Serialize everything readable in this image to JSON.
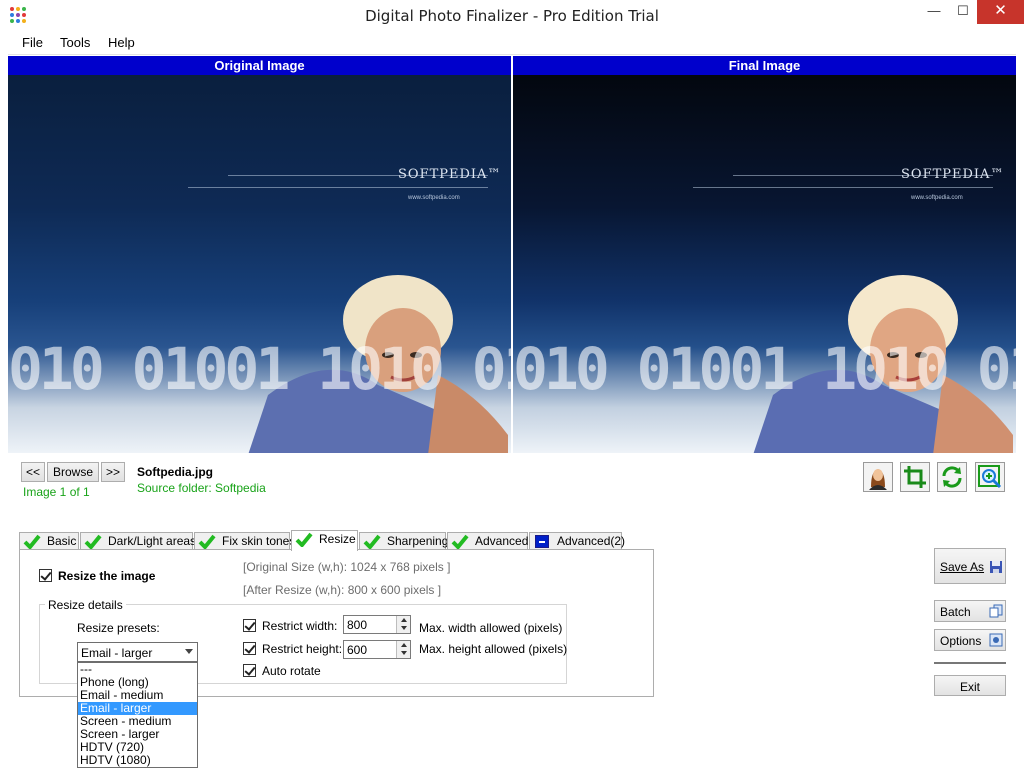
{
  "window": {
    "title": "Digital Photo Finalizer - Pro Edition Trial",
    "minimize_glyph": "—",
    "maximize_glyph": "☐",
    "close_glyph": "✕"
  },
  "menu": [
    "File",
    "Tools",
    "Help"
  ],
  "panels": {
    "original_label": "Original Image",
    "final_label": "Final Image",
    "brand": "SOFTPEDIA™",
    "url": "www.softpedia.com"
  },
  "navigation": {
    "prev_label": "<<",
    "browse_label": "Browse",
    "next_label": ">>",
    "image_counter": "Image 1 of 1",
    "file_name": "Softpedia.jpg",
    "source_folder": "Source folder: Softpedia"
  },
  "tools": [
    "portrait-icon",
    "crop-icon",
    "rotate-icon",
    "zoom-icon"
  ],
  "tabs": [
    {
      "label": "Basic",
      "icon": "check-icon"
    },
    {
      "label": "Dark/Light areas",
      "icon": "check-icon"
    },
    {
      "label": "Fix skin tones",
      "icon": "check-icon"
    },
    {
      "label": "Resize",
      "icon": "check-icon",
      "active": true
    },
    {
      "label": "Sharpening",
      "icon": "check-icon"
    },
    {
      "label": "Advanced",
      "icon": "check-icon"
    },
    {
      "label": "Advanced(2)",
      "icon": "minus-icon"
    }
  ],
  "resize": {
    "enable_label": "Resize the image",
    "enable_checked": true,
    "original_size": "[Original Size (w,h): 1024 x 768 pixels ]",
    "after_size": "[After Resize (w,h): 800 x 600 pixels ]",
    "details_label": "Resize details",
    "presets_label": "Resize presets:",
    "preset_selected": "Email - larger",
    "preset_options": [
      "---",
      "Phone (long)",
      "Email - medium",
      "Email - larger",
      "Screen - medium",
      "Screen - larger",
      "HDTV (720)",
      "HDTV (1080)"
    ],
    "restrict_width_label": "Restrict width:",
    "restrict_width_checked": true,
    "width_value": "800",
    "width_hint": "Max. width allowed (pixels)",
    "restrict_height_label": "Restrict height:",
    "restrict_height_checked": true,
    "height_value": "600",
    "height_hint": "Max. height allowed (pixels)",
    "auto_rotate_label": "Auto rotate",
    "auto_rotate_checked": true
  },
  "side_buttons": {
    "save_as": "Save As",
    "batch": "Batch",
    "options": "Options",
    "exit": "Exit"
  },
  "colors": {
    "panel_header": "#0000cc",
    "status_green": "#19a319",
    "tab_check": "#22bb22",
    "close_button": "#c7342b"
  }
}
